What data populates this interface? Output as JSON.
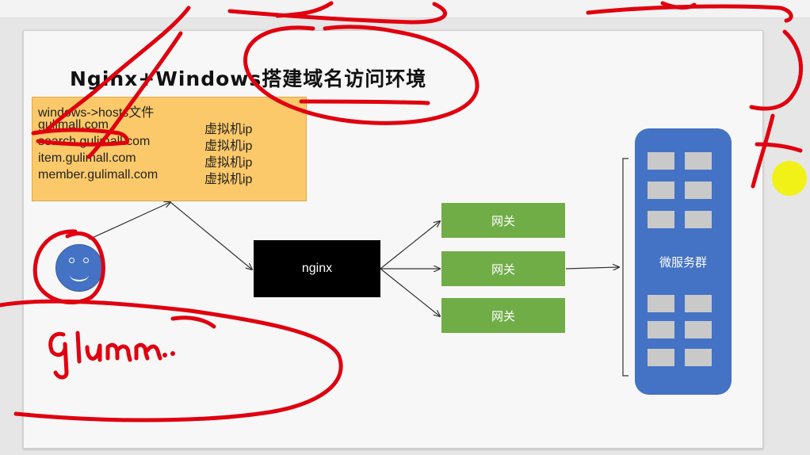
{
  "title": "Nginx+Windows搭建域名访问环境",
  "hosts": {
    "header": "windows->hosts文件",
    "rows": [
      {
        "domain": "gulimall.com",
        "ip": "虚拟机ip"
      },
      {
        "domain": "search.gulimall.com",
        "ip": "虚拟机ip"
      },
      {
        "domain": "item.gulimall.com",
        "ip": "虚拟机ip"
      },
      {
        "domain": "member.gulimall.com",
        "ip": "虚拟机ip"
      }
    ]
  },
  "nginx": "nginx",
  "gateways": [
    "网关",
    "网关",
    "网关"
  ],
  "microservices": "微服务群",
  "annotations": {
    "handwriting": "Glum.."
  },
  "colors": {
    "hosts_box": "#fbc96a",
    "gateway": "#70ad47",
    "microservice_cluster": "#4472c4",
    "person": "#4472c4",
    "annotation_ink": "#e0000f",
    "cursor_highlight": "#f2f200"
  }
}
